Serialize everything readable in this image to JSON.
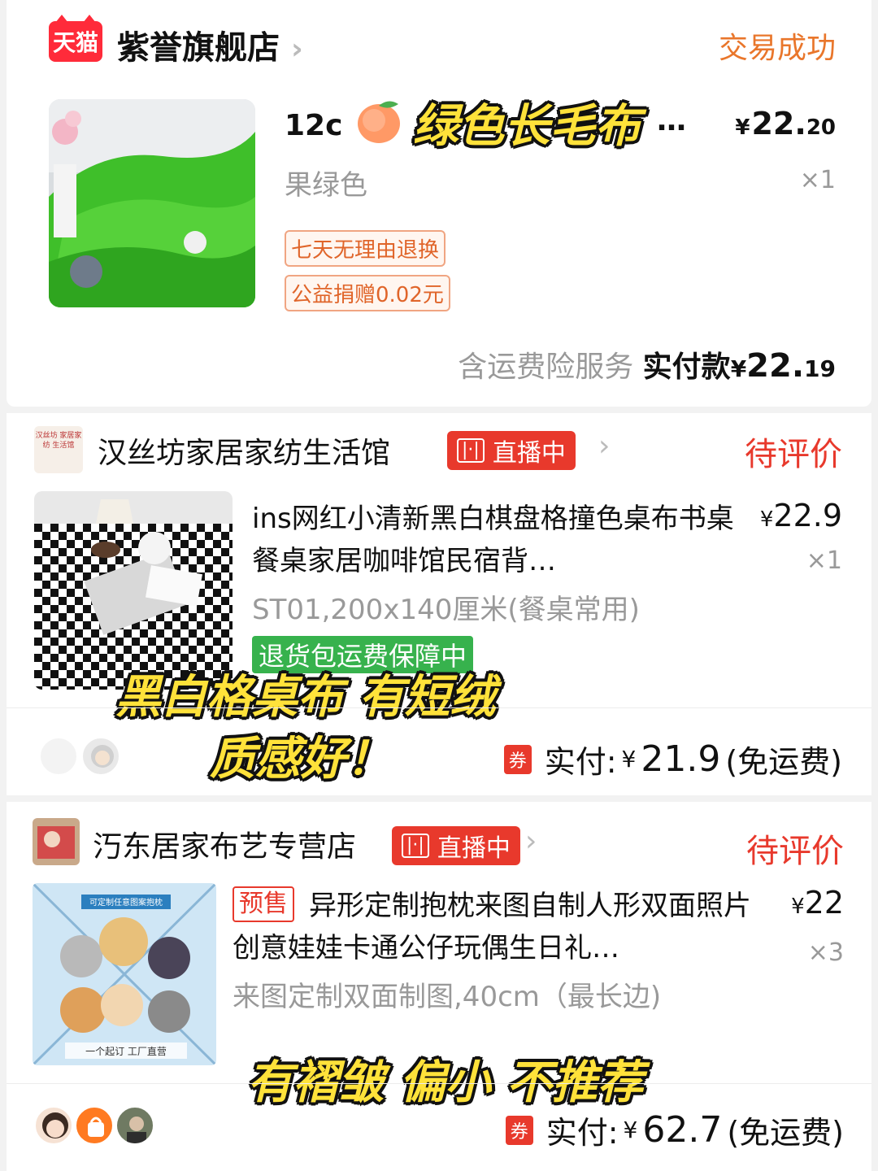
{
  "orders": [
    {
      "store_name": "紫誉旗舰店",
      "store_badge": "天猫",
      "status": "交易成功",
      "product_title": "12cm长毛绒绿色长毛布…",
      "title_visible": "12c",
      "price_yen": "¥",
      "price_main": "22.",
      "price_cents": "20",
      "variant": "果绿色",
      "quantity": "×1",
      "tags": [
        "七天无理由退换",
        "公益捐赠0.02元"
      ],
      "footer_service": "含运费险服务",
      "footer_pay_label": "实付款",
      "footer_yen": "¥",
      "footer_amount_main": "22.",
      "footer_amount_cents": "19"
    },
    {
      "store_name": "汉丝坊家居家纺生活馆",
      "store_logo_text": "汉丝坊 家居家纺 生活馆",
      "live_label": "直播中",
      "status": "待评价",
      "product_title": "ins网红小清新黑白棋盘格撞色桌布书桌餐桌家居咖啡馆民宿背…",
      "price": "22.9",
      "price_yen": "¥",
      "quantity": "×1",
      "variant": "ST01,200x140厘米(餐桌常用)",
      "green_tag": "退货包运费保障中",
      "coupon": "券",
      "pay_label": "实付:",
      "pay_yen": "¥",
      "pay_amount": "21.9",
      "pay_note": "(免运费)"
    },
    {
      "store_name": "汅东居家布艺专营店",
      "live_label": "直播中",
      "status": "待评价",
      "presale": "预售",
      "product_title": "异形定制抱枕来图自制人形双面照片创意娃娃卡通公仔玩偶生日礼…",
      "price": "22",
      "price_yen": "¥",
      "quantity": "×3",
      "variant": "来图定制双面制图,40cm（最长边)",
      "thumb_banner": "可定制任意图案抱枕",
      "thumb_footer": "一个起订 工厂直营",
      "coupon": "券",
      "pay_label": "实付:",
      "pay_yen": "¥",
      "pay_amount": "62.7",
      "pay_note": "(免运费)"
    }
  ],
  "captions": {
    "c1": "绿色长毛布",
    "c2": "黑白格桌布 有短绒",
    "c3": "质感好！",
    "c4": "有褶皱 偏小 不推荐"
  },
  "colors": {
    "tmall_red": "#ff2b3a",
    "status_orange": "#e9762b",
    "status_red": "#e8392c",
    "caption_yellow": "#ffe23a",
    "green_tag": "#37b24d"
  },
  "icons": [
    "chevron-right-icon",
    "live-bars-icon",
    "peach-emoji-icon",
    "coupon-icon"
  ]
}
